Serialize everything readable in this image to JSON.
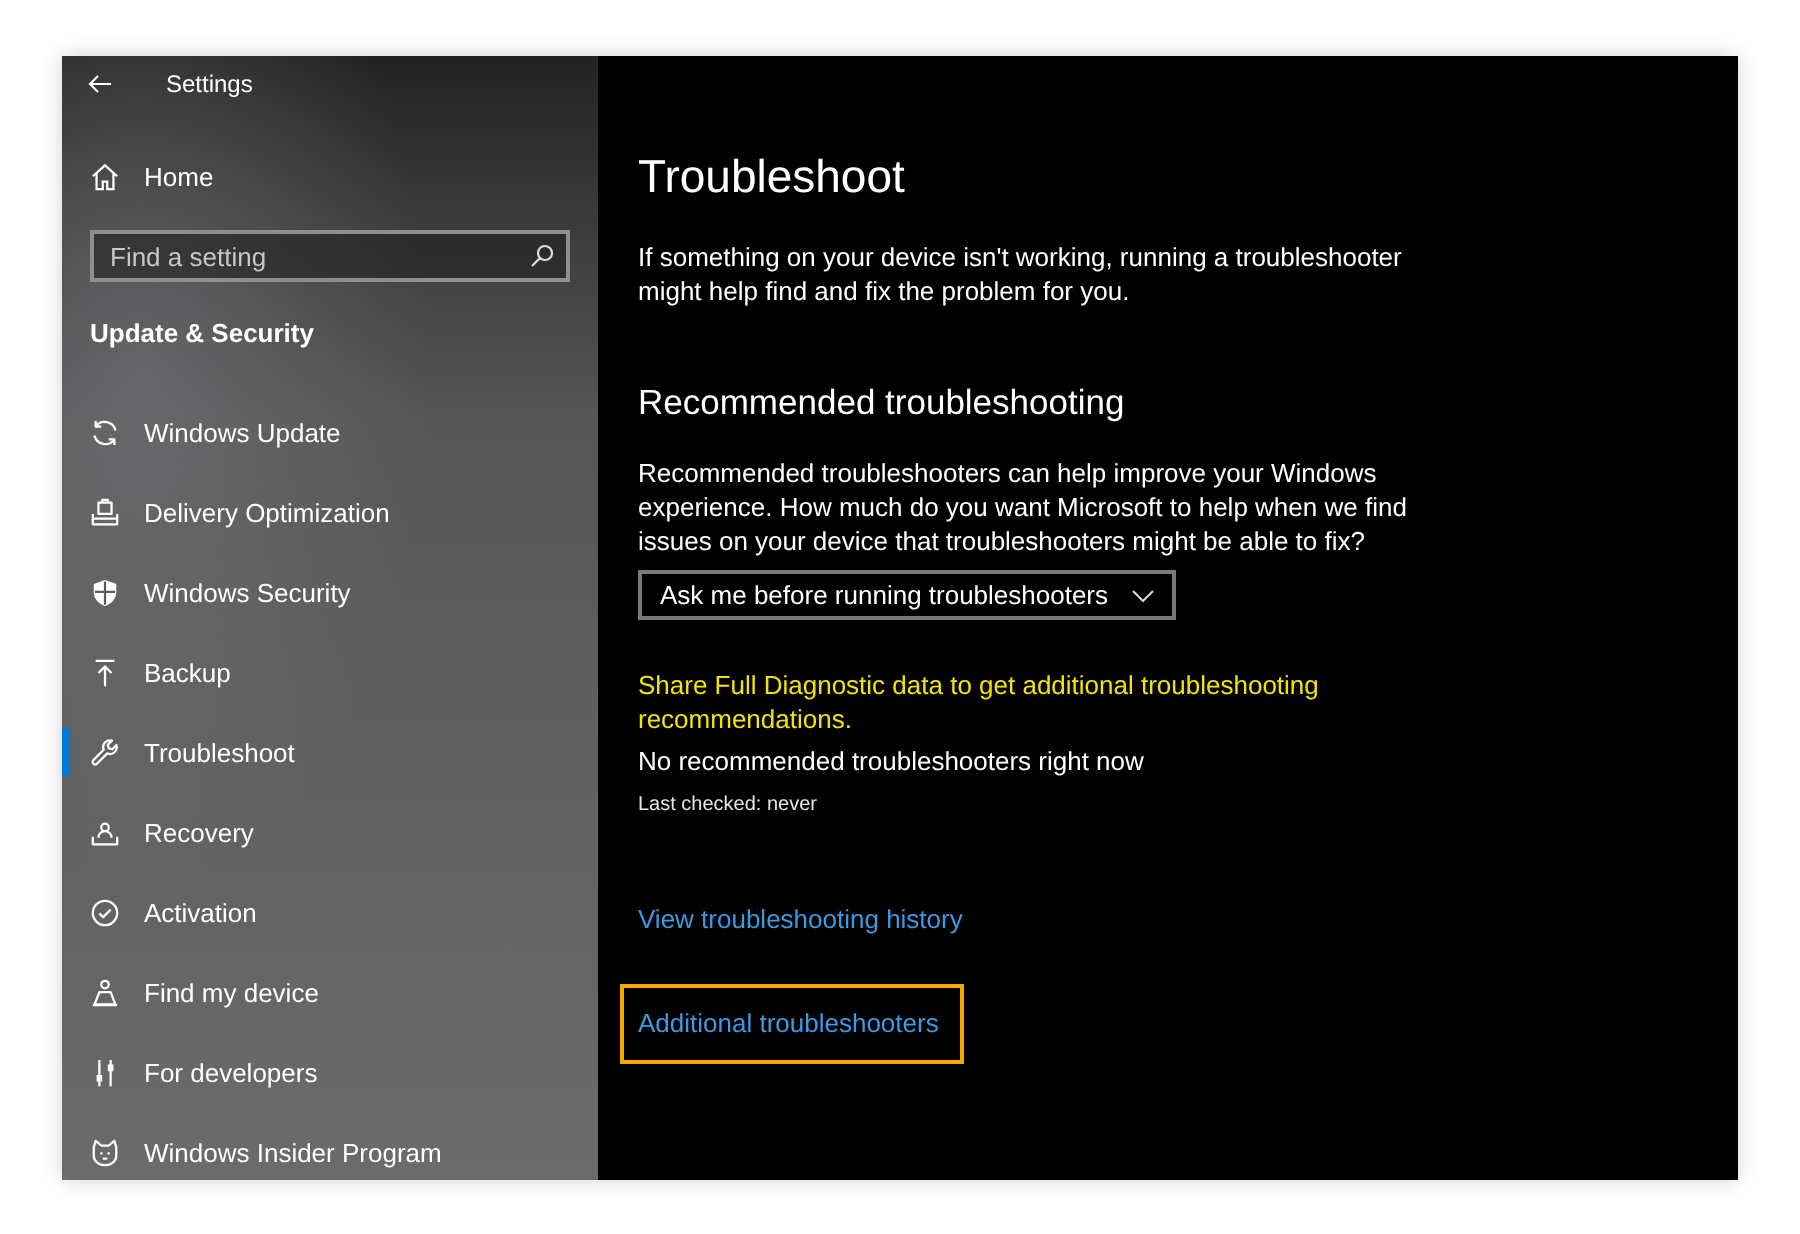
{
  "window": {
    "title": "Settings"
  },
  "sidebar": {
    "home": "Home",
    "search": {
      "placeholder": "Find a setting"
    },
    "section": "Update & Security",
    "items": [
      {
        "label": "Windows Update",
        "selected": false
      },
      {
        "label": "Delivery Optimization",
        "selected": false
      },
      {
        "label": "Windows Security",
        "selected": false
      },
      {
        "label": "Backup",
        "selected": false
      },
      {
        "label": "Troubleshoot",
        "selected": true
      },
      {
        "label": "Recovery",
        "selected": false
      },
      {
        "label": "Activation",
        "selected": false
      },
      {
        "label": "Find my device",
        "selected": false
      },
      {
        "label": "For developers",
        "selected": false
      },
      {
        "label": "Windows Insider Program",
        "selected": false
      }
    ]
  },
  "content": {
    "title": "Troubleshoot",
    "intro": "If something on your device isn't working, running a troubleshooter might help find and fix the problem for you.",
    "recommended": {
      "heading": "Recommended troubleshooting",
      "description": "Recommended troubleshooters can help improve your Windows experience. How much do you want Microsoft to help when we find issues on your device that troubleshooters might be able to fix?",
      "dropdown": {
        "value": "Ask me before running troubleshooters"
      },
      "diagnostic_link": "Share Full Diagnostic data to get additional troubleshooting recommendations.",
      "status": "No recommended troubleshooters right now",
      "last_checked": "Last checked: never"
    },
    "links": [
      {
        "label": "View troubleshooting history",
        "highlighted": false
      },
      {
        "label": "Additional troubleshooters",
        "highlighted": true
      }
    ]
  }
}
